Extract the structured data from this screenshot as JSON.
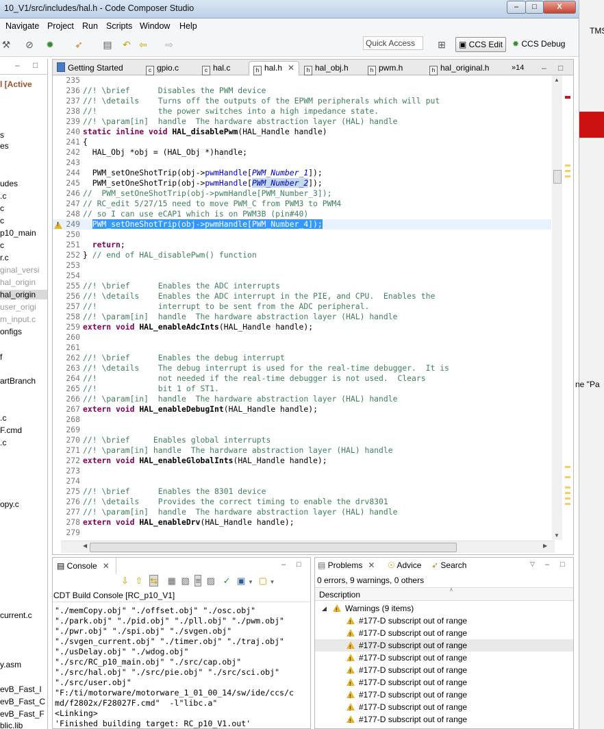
{
  "window": {
    "title": "10_V1/src/includes/hal.h - Code Composer Studio",
    "btn_min": "–",
    "btn_max": "□",
    "btn_close": "X",
    "right_strip_text": "TMS",
    "right_strip_text2": "ne \"Pa"
  },
  "menu": [
    "Navigate",
    "Project",
    "Run",
    "Scripts",
    "Window",
    "Help"
  ],
  "toolbar": {
    "quick_access_placeholder": "Quick Access",
    "ccs_edit": "CCS Edit",
    "ccs_debug": "CCS Debug"
  },
  "left_pane": {
    "items": [
      "l [Active",
      "s",
      "es",
      "udes",
      ".c",
      "c",
      "c",
      "p10_main",
      "c",
      "r.c",
      "ginal_versi",
      "hal_origin",
      "hal_origin",
      "user_origi",
      "m_input.c",
      "onfigs",
      "f",
      "artBranch",
      ".c",
      "F.cmd",
      ".c",
      "opy.c",
      "current.c",
      "y.asm",
      "evB_Fast_I",
      "evB_Fast_C",
      "evB_Fast_F",
      "blic.lib"
    ]
  },
  "editor": {
    "tabs": [
      "Getting Started",
      "gpio.c",
      "hal.c",
      "hal.h",
      "hal_obj.h",
      "pwm.h",
      "hal_original.h"
    ],
    "active_tab": "hal.h",
    "overflow_count": "»14",
    "warning_marker_line": "249",
    "lines": [
      {
        "n": "235",
        "t": ""
      },
      {
        "n": "236",
        "t": "//! \\brief      Disables the PWM device"
      },
      {
        "n": "237",
        "t": "//! \\details    Turns off the outputs of the EPWM peripherals which will put"
      },
      {
        "n": "238",
        "t": "//!             the power switches into a high impedance state."
      },
      {
        "n": "239",
        "t": "//! \\param[in]  handle  The hardware abstraction layer (HAL) handle"
      },
      {
        "n": "240",
        "t": "static inline void HAL_disablePwm(HAL_Handle handle)"
      },
      {
        "n": "241",
        "t": "{"
      },
      {
        "n": "242",
        "t": "  HAL_Obj *obj = (HAL_Obj *)handle;"
      },
      {
        "n": "243",
        "t": ""
      },
      {
        "n": "244",
        "t": "  PWM_setOneShotTrip(obj->pwmHandle[PWM_Number_1]);"
      },
      {
        "n": "245",
        "t": "  PWM_setOneShotTrip(obj->pwmHandle[PWM_Number_2]);"
      },
      {
        "n": "246",
        "t": "//  PWM_setOneShotTrip(obj->pwmHandle[PWM_Number_3]);"
      },
      {
        "n": "247",
        "t": "// RC_edit 5/27/15 need to move PWM_C from PWM3 to PWM4"
      },
      {
        "n": "248",
        "t": "// so I can use eCAP1 which is on PWM3B (pin#40)"
      },
      {
        "n": "249",
        "t": "  PWM_setOneShotTrip(obj->pwmHandle[PWM_Number_4]);"
      },
      {
        "n": "250",
        "t": ""
      },
      {
        "n": "251",
        "t": "  return;"
      },
      {
        "n": "252",
        "t": "} // end of HAL_disablePwm() function"
      },
      {
        "n": "253",
        "t": ""
      },
      {
        "n": "254",
        "t": ""
      },
      {
        "n": "255",
        "t": "//! \\brief      Enables the ADC interrupts"
      },
      {
        "n": "256",
        "t": "//! \\details    Enables the ADC interrupt in the PIE, and CPU.  Enables the"
      },
      {
        "n": "257",
        "t": "//!             interrupt to be sent from the ADC peripheral."
      },
      {
        "n": "258",
        "t": "//! \\param[in]  handle  The hardware abstraction layer (HAL) handle"
      },
      {
        "n": "259",
        "t": "extern void HAL_enableAdcInts(HAL_Handle handle);"
      },
      {
        "n": "260",
        "t": ""
      },
      {
        "n": "261",
        "t": ""
      },
      {
        "n": "262",
        "t": "//! \\brief      Enables the debug interrupt"
      },
      {
        "n": "263",
        "t": "//! \\details    The debug interrupt is used for the real-time debugger.  It is"
      },
      {
        "n": "264",
        "t": "//!             not needed if the real-time debugger is not used.  Clears"
      },
      {
        "n": "265",
        "t": "//!             bit 1 of ST1."
      },
      {
        "n": "266",
        "t": "//! \\param[in]  handle  The hardware abstraction layer (HAL) handle"
      },
      {
        "n": "267",
        "t": "extern void HAL_enableDebugInt(HAL_Handle handle);"
      },
      {
        "n": "268",
        "t": ""
      },
      {
        "n": "269",
        "t": ""
      },
      {
        "n": "270",
        "t": "//! \\brief     Enables global interrupts"
      },
      {
        "n": "271",
        "t": "//! \\param[in] handle  The hardware abstraction layer (HAL) handle"
      },
      {
        "n": "272",
        "t": "extern void HAL_enableGlobalInts(HAL_Handle handle);"
      },
      {
        "n": "273",
        "t": ""
      },
      {
        "n": "274",
        "t": ""
      },
      {
        "n": "275",
        "t": "//! \\brief      Enables the 8301 device"
      },
      {
        "n": "276",
        "t": "//! \\details    Provides the correct timing to enable the drv8301"
      },
      {
        "n": "277",
        "t": "//! \\param[in]  handle  The hardware abstraction layer (HAL) handle"
      },
      {
        "n": "278",
        "t": "extern void HAL_enableDrv(HAL_Handle handle);"
      },
      {
        "n": "279",
        "t": ""
      }
    ]
  },
  "console": {
    "tab_label": "Console",
    "header": "CDT Build Console [RC_p10_V1]",
    "lines": [
      "\"./memCopy.obj\" \"./offset.obj\" \"./osc.obj\"",
      "\"./park.obj\" \"./pid.obj\" \"./pll.obj\" \"./pwm.obj\"",
      "\"./pwr.obj\" \"./spi.obj\" \"./svgen.obj\"",
      "\"./svgen_current.obj\" \"./timer.obj\" \"./traj.obj\"",
      "\"./usDelay.obj\" \"./wdog.obj\"",
      "\"./src/RC_p10_main.obj\" \"./src/cap.obj\"",
      "\"./src/hal.obj\" \"./src/pie.obj\" \"./src/sci.obj\"",
      "\"./src/user.obj\"",
      "\"F:/ti/motorware/motorware_1_01_00_14/sw/ide/ccs/c",
      "md/f2802x/F28027F.cmd\"  -l\"libc.a\"",
      "<Linking>",
      "'Finished building target: RC_p10_V1.out'"
    ]
  },
  "problems": {
    "tab_problems": "Problems",
    "tab_advice": "Advice",
    "tab_search": "Search",
    "summary": "0 errors, 9 warnings, 0 others",
    "column": "Description",
    "group": "Warnings (9 items)",
    "items": [
      "#177-D subscript out of range",
      "#177-D subscript out of range",
      "#177-D subscript out of range",
      "#177-D subscript out of range",
      "#177-D subscript out of range",
      "#177-D subscript out of range",
      "#177-D subscript out of range",
      "#177-D subscript out of range",
      "#177-D subscript out of range"
    ]
  },
  "colors": {
    "comment": "#3f7f5f",
    "keyword": "#7f0055",
    "field": "#0000c0",
    "selection": "#3399ff",
    "warning": "#e8b422"
  }
}
